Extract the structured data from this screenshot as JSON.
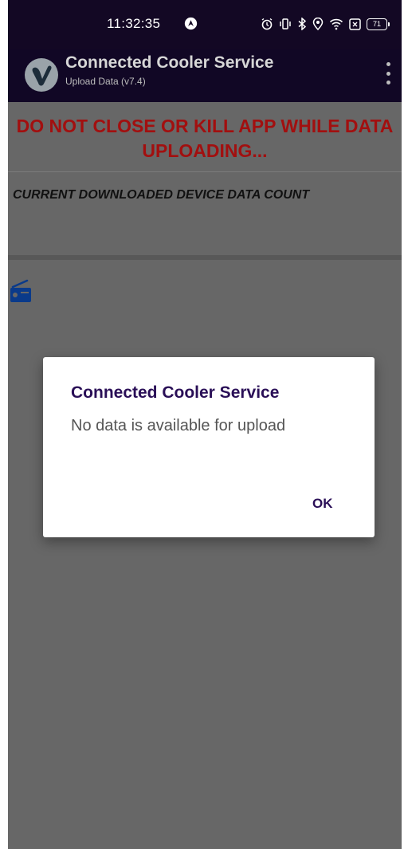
{
  "status_bar": {
    "time": "11:32:35",
    "battery_level": "71",
    "icons": [
      "navigation-icon",
      "alarm-icon",
      "vibrate-icon",
      "bluetooth-icon",
      "location-icon",
      "wifi-icon",
      "screen-cast-icon",
      "battery-icon"
    ]
  },
  "app_bar": {
    "title": "Connected Cooler Service",
    "subtitle": "Upload Data (v7.4)",
    "menu_icon": "more-vertical-icon"
  },
  "main": {
    "warning_line1": "DO NOT CLOSE OR KILL APP WHILE DATA",
    "warning_line2": "UPLOADING...",
    "count_label": "CURRENT DOWNLOADED DEVICE DATA COUNT",
    "device_icon": "radio-device-icon"
  },
  "dialog": {
    "title": "Connected Cooler Service",
    "message": "No data is available for upload",
    "ok_label": "OK"
  },
  "colors": {
    "status_bar_bg": "#130824",
    "app_bar_bg": "#110725",
    "warning_text": "#a20f0f",
    "dialog_accent": "#2a0f57",
    "scrim_bg": "#676767",
    "device_icon": "#0a3a8a"
  }
}
